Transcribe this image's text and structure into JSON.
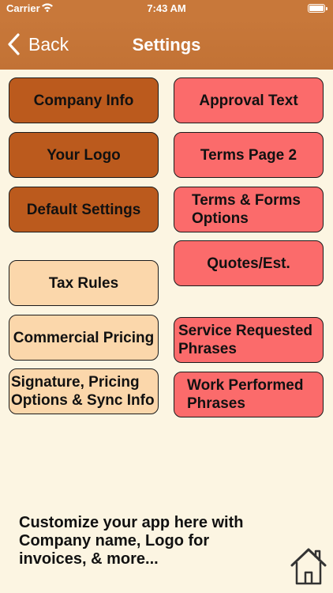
{
  "status_bar": {
    "carrier": "Carrier",
    "time": "7:43 AM"
  },
  "nav": {
    "back_label": "Back",
    "title": "Settings"
  },
  "buttons": {
    "company_info": "Company Info",
    "your_logo": "Your Logo",
    "default_settings": "Default Settings",
    "tax_rules": "Tax Rules",
    "commercial_pricing": "Commercial Pricing",
    "signature_pricing": "Signature, Pricing\nOptions & Sync Info",
    "approval_text": "Approval Text",
    "terms_page_2": "Terms Page 2",
    "terms_forms_options": "Terms & Forms\nOptions",
    "quotes_est": "Quotes/Est.",
    "service_requested_phrases": "Service Requested\nPhrases",
    "work_performed_phrases": "Work Performed\nPhrases"
  },
  "footer": {
    "text": "Customize your app here with Company name, Logo for invoices, & more..."
  },
  "colors": {
    "nav_bar": "#c8783a",
    "background": "#fcf5e2",
    "brown_button": "#bb5a1d",
    "pink_button": "#fb6b6b",
    "peach_button": "#fbd7ab"
  },
  "icons": [
    "wifi-icon",
    "battery-icon",
    "chevron-left-icon",
    "home-icon"
  ]
}
